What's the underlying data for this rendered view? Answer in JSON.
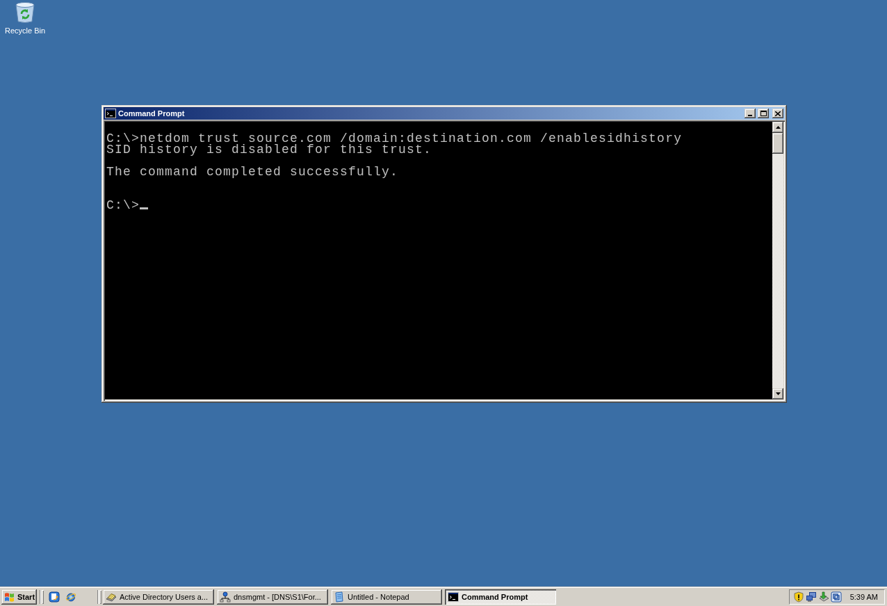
{
  "desktop": {
    "icons": [
      {
        "label": "Recycle Bin"
      }
    ]
  },
  "window": {
    "title": "Command Prompt",
    "active": true,
    "console": {
      "session": [
        {
          "prompt": "C:\\>",
          "command": "netdom trust source.com /domain:destination.com /enablesidhistory",
          "output": [
            [
              "SID history is disabled for this trust."
            ],
            [
              "The command completed successfully."
            ]
          ]
        },
        {
          "prompt": "C:\\>",
          "cursor": true
        }
      ]
    }
  },
  "taskbar": {
    "start": {
      "label": "Start"
    },
    "tasks": [
      {
        "label": "Active Directory Users a...",
        "selected": false
      },
      {
        "label": "dnsmgmt - [DNS\\S1\\For...",
        "selected": false
      },
      {
        "label": "Untitled - Notepad",
        "selected": false
      },
      {
        "label": "Command Prompt",
        "selected": true
      }
    ],
    "clock": "5:39 AM"
  }
}
